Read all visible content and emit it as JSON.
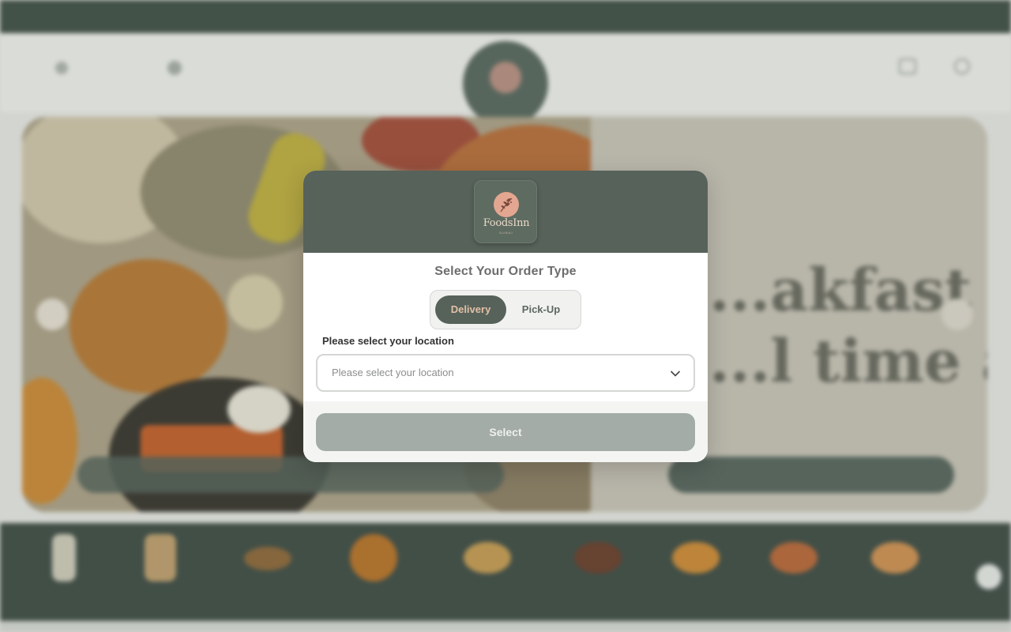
{
  "background_page": {
    "promo_text": "",
    "language_label": "",
    "phone_label": "",
    "signin_label": "",
    "hero": {
      "kicker": "",
      "headline_line1": "...akfast",
      "headline_line2": "...l time at",
      "subline": "",
      "cta_label": ""
    },
    "categories": [
      "",
      "",
      "",
      "",
      "",
      "",
      "",
      "",
      ""
    ]
  },
  "modal": {
    "logo": {
      "brand": "FoodsInn",
      "tagline": "DUBAI"
    },
    "title": "Select Your Order Type",
    "order_types": {
      "delivery_label": "Delivery",
      "pickup_label": "Pick-Up",
      "selected": "Delivery"
    },
    "location": {
      "label": "Please select your location",
      "placeholder": "Please select your location",
      "value": ""
    },
    "select_button_label": "Select"
  },
  "colors": {
    "brand_dark_green": "#56625a",
    "active_toggle_text": "#e2c0a6",
    "logo_circle": "#e3a690",
    "disabled_button": "#a3aca7"
  },
  "icons": {
    "location_dropdown": "chevron-down-icon",
    "logo_emblem": "leaf-branch-icon"
  }
}
